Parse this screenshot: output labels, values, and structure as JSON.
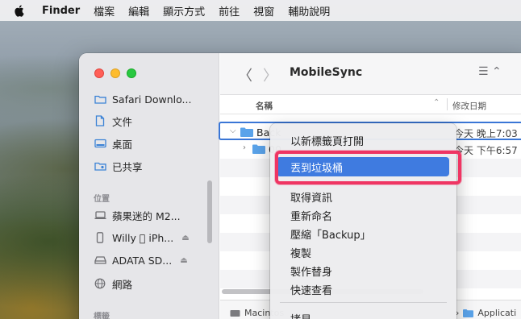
{
  "menubar": {
    "app": "Finder",
    "items": [
      "檔案",
      "編輯",
      "顯示方式",
      "前往",
      "視窗",
      "輔助說明"
    ]
  },
  "window": {
    "title": "MobileSync"
  },
  "sidebar": {
    "favorites": [
      {
        "label": "Safari Downlo...",
        "icon": "folder-icon"
      },
      {
        "label": "文件",
        "icon": "document-icon"
      },
      {
        "label": "桌面",
        "icon": "desktop-icon"
      },
      {
        "label": "已共享",
        "icon": "shared-folder-icon"
      }
    ],
    "locations_heading": "位置",
    "locations": [
      {
        "label": "蘋果迷的 M2...",
        "icon": "laptop-icon"
      },
      {
        "label": "Willy  iPh...",
        "icon": "iphone-icon",
        "eject": true
      },
      {
        "label": "ADATA SD...",
        "icon": "external-drive-icon",
        "eject": true
      },
      {
        "label": "網路",
        "icon": "network-icon"
      }
    ],
    "tags_heading": "標籤"
  },
  "columns": {
    "name": "名稱",
    "date": "修改日期"
  },
  "rows": [
    {
      "name": "Back",
      "date": "今天 晚上7:03",
      "expanded": true,
      "selected": true
    },
    {
      "name": "00",
      "date": "今天 下午6:57",
      "expanded": false,
      "selected": false
    }
  ],
  "context_menu": {
    "items": [
      "以新標籤頁打開",
      "丟到垃圾桶",
      "取得資訊",
      "重新命名",
      "壓縮「Backup」",
      "複製",
      "製作替身",
      "快速查看",
      "拷貝"
    ],
    "highlighted": "丟到垃圾桶"
  },
  "pathbar": {
    "start": "Macintos",
    "end": "Applicati"
  },
  "colors": {
    "accent": "#3f7be0",
    "annotation_ring": "#ef3563"
  }
}
